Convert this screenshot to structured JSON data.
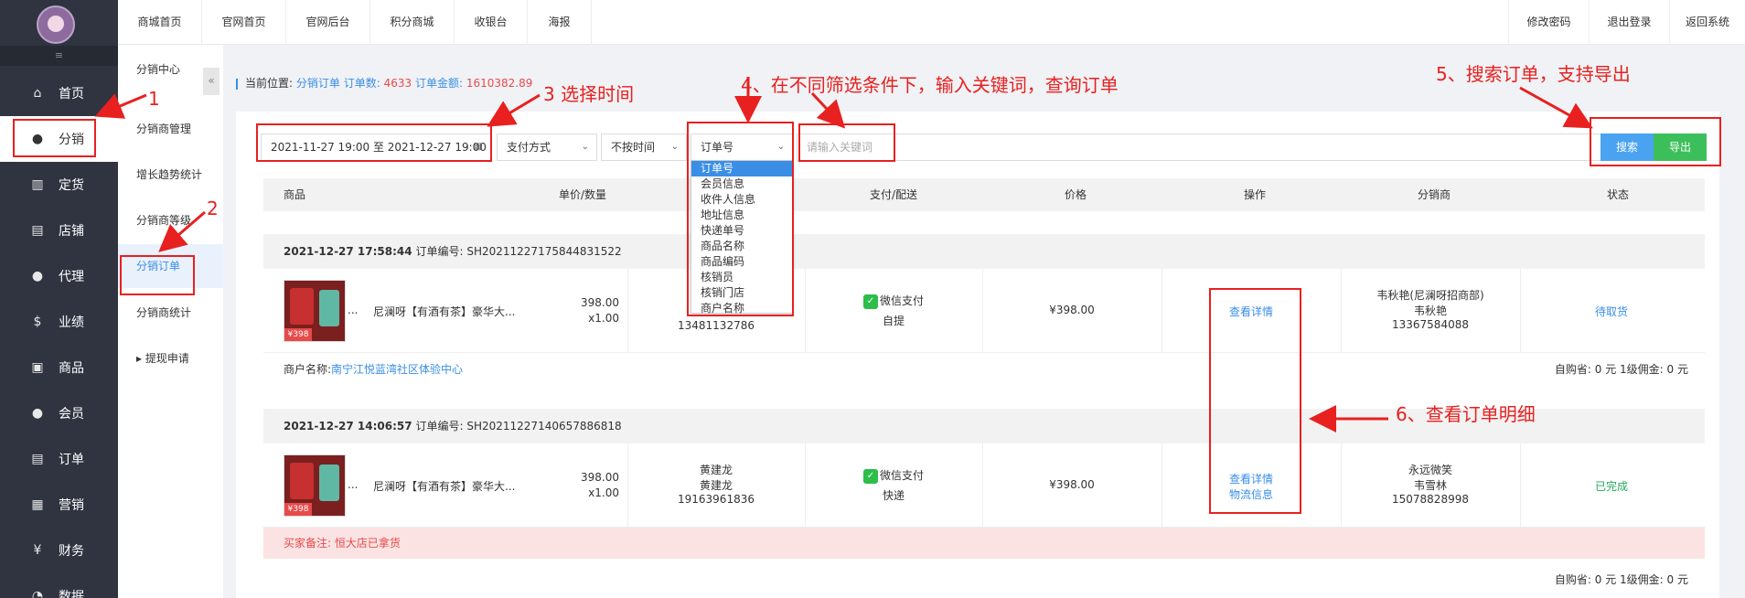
{
  "sidebar": {
    "collapse_icon": "≡",
    "items": [
      {
        "label": "首页",
        "icon": "home-icon",
        "glyph": "⌂"
      },
      {
        "label": "分销",
        "icon": "user-icon",
        "glyph": "●"
      },
      {
        "label": "定货",
        "icon": "chart-icon",
        "glyph": "▥"
      },
      {
        "label": "店铺",
        "icon": "store-icon",
        "glyph": "▤"
      },
      {
        "label": "代理",
        "icon": "user-icon",
        "glyph": "●"
      },
      {
        "label": "业绩",
        "icon": "dollar-icon",
        "glyph": "$"
      },
      {
        "label": "商品",
        "icon": "image-icon",
        "glyph": "▣"
      },
      {
        "label": "会员",
        "icon": "user-icon",
        "glyph": "●"
      },
      {
        "label": "订单",
        "icon": "document-icon",
        "glyph": "▤"
      },
      {
        "label": "营销",
        "icon": "gift-icon",
        "glyph": "▦"
      },
      {
        "label": "财务",
        "icon": "moneybag-icon",
        "glyph": "¥"
      },
      {
        "label": "数据",
        "icon": "data-icon",
        "glyph": "◔"
      }
    ]
  },
  "subnav": {
    "collapse_icon": "«",
    "items": [
      "分销中心",
      "分销商管理",
      "增长趋势统计",
      "分销商等级",
      "分销订单",
      "分销商统计",
      "提现申请"
    ]
  },
  "topbar": {
    "left": [
      "商城首页",
      "官网首页",
      "官网后台",
      "积分商城",
      "收银台",
      "海报"
    ],
    "right": [
      "修改密码",
      "退出登录",
      "返回系统"
    ]
  },
  "breadcrumb": {
    "prefix": "当前位置:",
    "page": "分销订单",
    "count_label": "订单数:",
    "count": "4633",
    "amount_label": "订单金额:",
    "amount": "1610382.89"
  },
  "filters": {
    "date_range": "2021-11-27 19:00 至 2021-12-27 19:00",
    "payment": "支付方式",
    "time": "不按时间",
    "field": "订单号",
    "keyword_placeholder": "请输入关键词",
    "search": "搜索",
    "export": "导出",
    "options": [
      "订单号",
      "会员信息",
      "收件人信息",
      "地址信息",
      "快递单号",
      "商品名称",
      "商品编码",
      "核销员",
      "核销门店",
      "商户名称"
    ]
  },
  "table_headers": [
    "商品",
    "单价/数量",
    "支付/配送",
    "价格",
    "操作",
    "分销商",
    "状态"
  ],
  "orders": [
    {
      "time": "2021-12-27 17:58:44",
      "no_label": "订单编号:",
      "no": "SH20211227175844831522",
      "product": "尼澜呀【有酒有茶】豪华大...",
      "price": "398.00",
      "qty": "x1.00",
      "buyer_phone": "13481132786",
      "pay": "微信支付",
      "delivery": "自提",
      "total": "¥398.00",
      "action1": "查看详情",
      "dist_name": "韦秋艳(尼澜呀招商部)",
      "dist_name2": "韦秋艳",
      "dist_phone": "13367584088",
      "status": "待取货",
      "merchant_label": "商户名称:",
      "merchant": "南宁江悦蓝湾社区体验中心",
      "footer": "自购省: 0 元 1级佣金: 0 元"
    },
    {
      "time": "2021-12-27 14:06:57",
      "no_label": "订单编号:",
      "no": "SH20211227140657886818",
      "product": "尼澜呀【有酒有茶】豪华大...",
      "price": "398.00",
      "qty": "x1.00",
      "buyer_name": "黄建龙",
      "buyer_name2": "黄建龙",
      "buyer_phone": "19163961836",
      "pay": "微信支付",
      "delivery": "快递",
      "total": "¥398.00",
      "action1": "查看详情",
      "action2": "物流信息",
      "dist_name": "永远微笑",
      "dist_name2": "韦雪林",
      "dist_phone": "15078828998",
      "status": "已完成",
      "remark": "买家备注: 恒大店已拿货",
      "footer": "自购省: 0 元 1级佣金: 0 元"
    }
  ],
  "thumb_price": "¥398",
  "annotations": {
    "a1": "1",
    "a2": "2",
    "a3": "3 选择时间",
    "a4": "4、在不同筛选条件下，输入关键词，查询订单",
    "a5": "5、搜索订单，支持导出",
    "a6": "6、查看订单明细"
  },
  "colors": {
    "accent": "#3a8ee6",
    "annotation": "#e82020",
    "sidebar": "#2f3440",
    "search": "#4aa3f0",
    "export": "#3cbf5a"
  }
}
